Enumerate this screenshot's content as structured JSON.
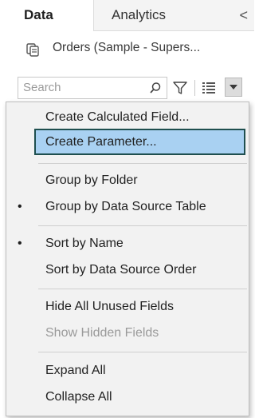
{
  "tabs": {
    "data_label": "Data",
    "analytics_label": "Analytics",
    "collapse_glyph": "<"
  },
  "datasource": {
    "name": "Orders (Sample - Supers...",
    "icon": "datasource-icon"
  },
  "search": {
    "placeholder": "Search",
    "icons": [
      "search-icon",
      "filter-icon",
      "list-view-icon",
      "chevron-down-icon"
    ]
  },
  "menu": {
    "items": [
      {
        "label": "Create Calculated Field...",
        "bullet": "",
        "state": "normal"
      },
      {
        "label": "Create Parameter...",
        "bullet": "",
        "state": "highlighted"
      },
      {
        "label": "Group by Folder",
        "bullet": "",
        "state": "normal"
      },
      {
        "label": "Group by Data Source Table",
        "bullet": "•",
        "state": "normal"
      },
      {
        "label": "Sort by Name",
        "bullet": "•",
        "state": "normal"
      },
      {
        "label": "Sort by Data Source Order",
        "bullet": "",
        "state": "normal"
      },
      {
        "label": "Hide All Unused Fields",
        "bullet": "",
        "state": "normal"
      },
      {
        "label": "Show Hidden Fields",
        "bullet": "",
        "state": "disabled"
      },
      {
        "label": "Expand All",
        "bullet": "",
        "state": "normal"
      },
      {
        "label": "Collapse All",
        "bullet": "",
        "state": "normal"
      }
    ]
  },
  "colors": {
    "highlight": "#a9d1f2",
    "focus_border": "#1f4f4f",
    "menu_bg": "#f2f2f2",
    "disabled_text": "#9a9a9a"
  }
}
